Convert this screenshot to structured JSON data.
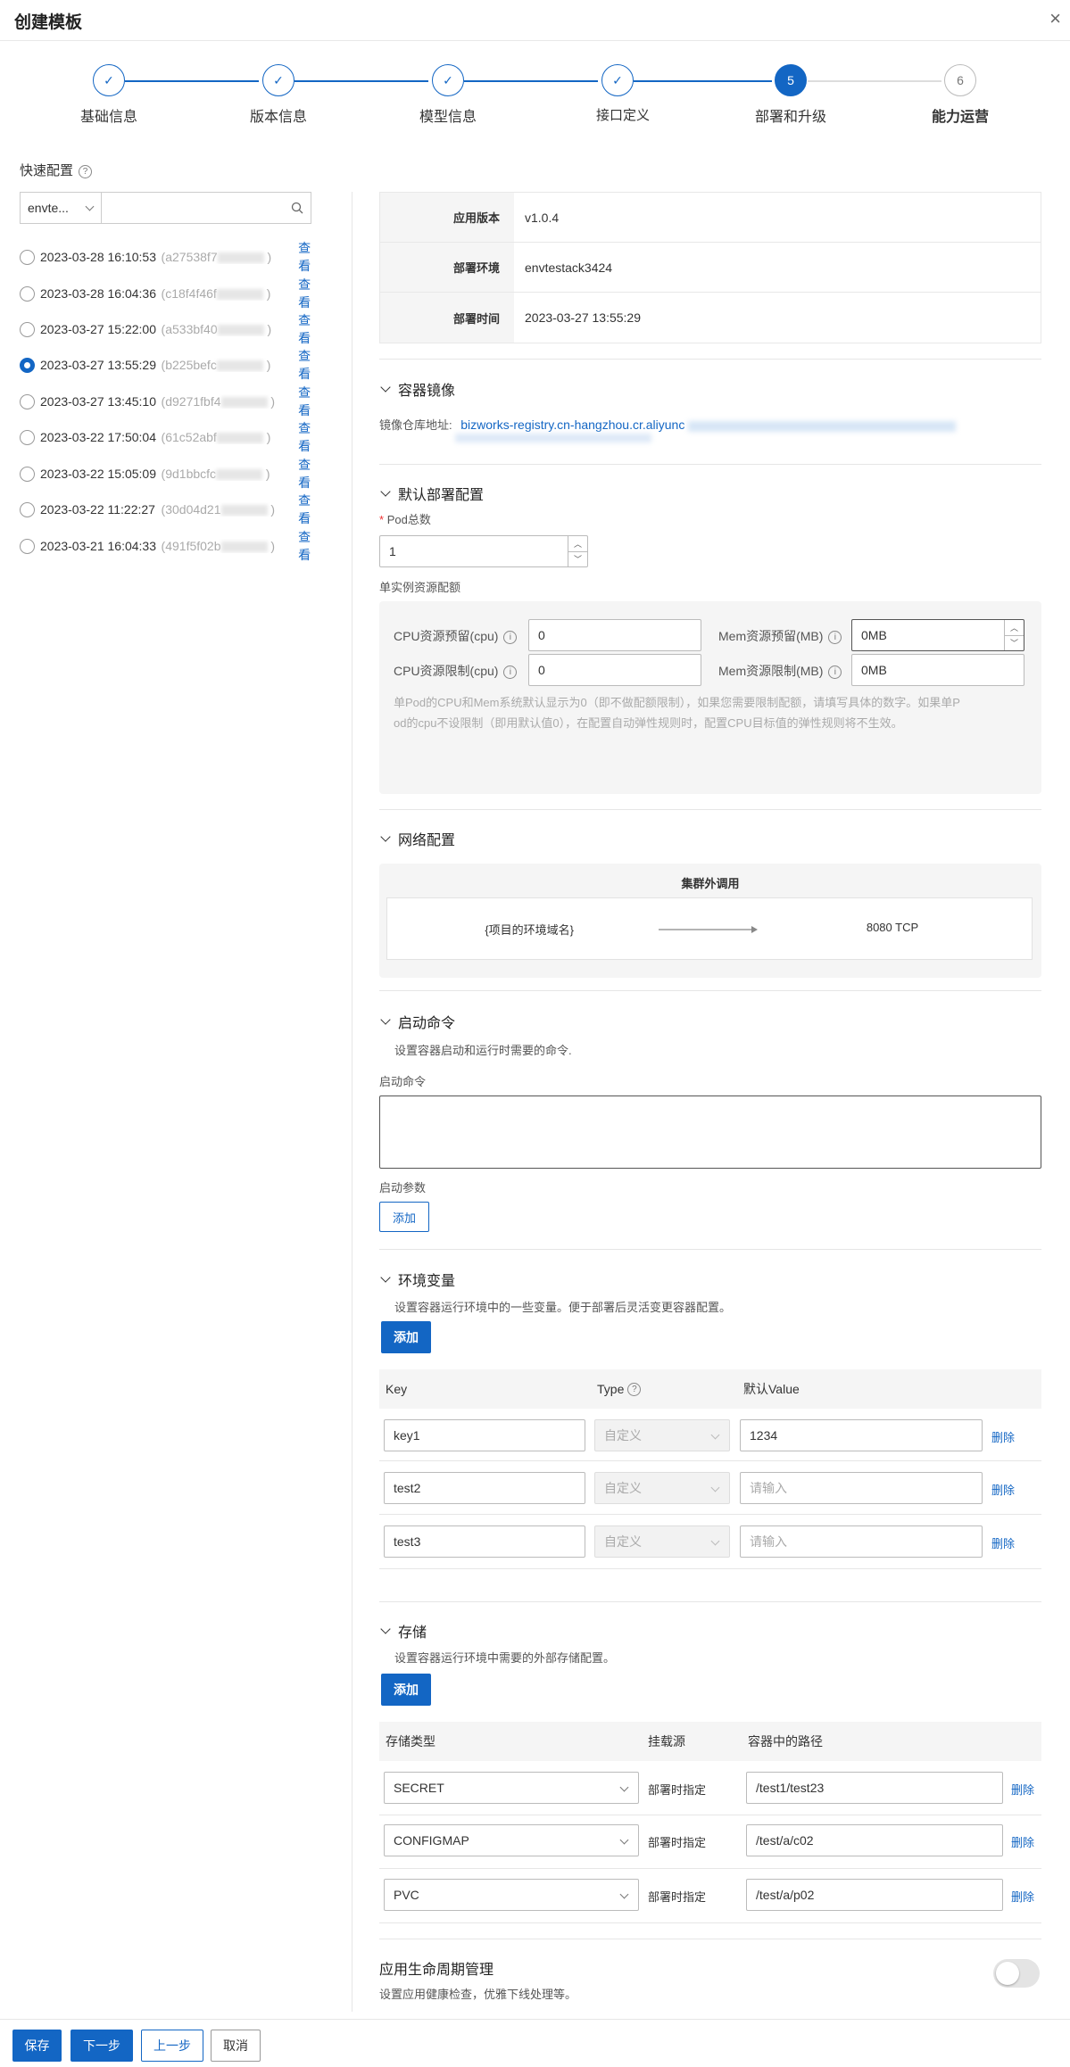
{
  "window": {
    "title": "创建模板",
    "close": "×"
  },
  "steps": [
    {
      "label": "基础信息",
      "mark": "✓"
    },
    {
      "label": "版本信息",
      "mark": "✓"
    },
    {
      "label": "模型信息",
      "mark": "✓"
    },
    {
      "label": "接口定义",
      "mark": "✓"
    },
    {
      "label": "部署和升级",
      "mark": "5"
    },
    {
      "label": "能力运营",
      "mark": "6"
    }
  ],
  "quick_config": {
    "title": "快速配置",
    "help": "?",
    "env_value": "envte...",
    "search_placeholder": "",
    "history": [
      {
        "time": "2023-03-28 16:10:53",
        "hash": "(a27538f7",
        "close": ")",
        "action": "查看"
      },
      {
        "time": "2023-03-28 16:04:36",
        "hash": "(c18f4f46f",
        "close": ")",
        "action": "查看"
      },
      {
        "time": "2023-03-27 15:22:00",
        "hash": "(a533bf40",
        "close": ")",
        "action": "查看"
      },
      {
        "time": "2023-03-27 13:55:29",
        "hash": "(b225befc",
        "close": ")",
        "action": "查看"
      },
      {
        "time": "2023-03-27 13:45:10",
        "hash": "(d9271fbf4",
        "close": ")",
        "action": "查看"
      },
      {
        "time": "2023-03-22 17:50:04",
        "hash": "(61c52abf",
        "close": ")",
        "action": "查看"
      },
      {
        "time": "2023-03-22 15:05:09",
        "hash": "(9d1bbcfc",
        "close": ")",
        "action": "查看"
      },
      {
        "time": "2023-03-22 11:22:27",
        "hash": "(30d04d21",
        "close": ")",
        "action": "查看"
      },
      {
        "time": "2023-03-21 16:04:33",
        "hash": "(491f5f02b",
        "close": ")",
        "action": "查看"
      }
    ]
  },
  "info": [
    {
      "key": "应用版本",
      "value": "v1.0.4"
    },
    {
      "key": "部署环境",
      "value": "envtestack3424"
    },
    {
      "key": "部署时间",
      "value": "2023-03-27 13:55:29"
    }
  ],
  "image": {
    "title": "容器镜像",
    "repo_label": "镜像仓库地址:",
    "repo_value": "bizworks-registry.cn-hangzhou.cr.aliyunc"
  },
  "deploy": {
    "title": "默认部署配置",
    "pod_label": "Pod总数",
    "pod_value": "1",
    "quota_label": "单实例资源配额",
    "cpu_req_label": "CPU资源预留(cpu)",
    "cpu_req_value": "0",
    "mem_req_label": "Mem资源预留(MB)",
    "mem_req_value": "0MB",
    "cpu_lim_label": "CPU资源限制(cpu)",
    "cpu_lim_value": "0",
    "mem_lim_label": "Mem资源限制(MB)",
    "mem_lim_value": "0MB",
    "note_line1": "单Pod的CPU和Mem系统默认显示为0（即不做配额限制），如果您需要限制配额，请填写具体的数字。如果单P",
    "note_line2": "od的cpu不设限制（即用默认值0），在配置自动弹性规则时，配置CPU目标值的弹性规则将不生效。"
  },
  "network": {
    "title": "网络配置",
    "card_title": "集群外调用",
    "source": "{项目的环境域名}",
    "target": "8080 TCP"
  },
  "startup": {
    "title": "启动命令",
    "desc": "设置容器启动和运行时需要的命令.",
    "cmd_label": "启动命令",
    "args_label": "启动参数",
    "add": "添加"
  },
  "env": {
    "title": "环境变量",
    "desc": "设置容器运行环境中的一些变量。便于部署后灵活变更容器配置。",
    "add": "添加",
    "headers": {
      "key": "Key",
      "type": "Type",
      "value": "默认Value"
    },
    "rows": [
      {
        "key": "key1",
        "type": "自定义",
        "value": "1234",
        "action": "删除"
      },
      {
        "key": "test2",
        "type": "自定义",
        "value": "请输入",
        "action": "删除"
      },
      {
        "key": "test3",
        "type": "自定义",
        "value": "请输入",
        "action": "删除"
      }
    ]
  },
  "storage": {
    "title": "存储",
    "desc": "设置容器运行环境中需要的外部存储配置。",
    "add": "添加",
    "headers": {
      "type": "存储类型",
      "source": "挂载源",
      "path": "容器中的路径"
    },
    "rows": [
      {
        "type": "SECRET",
        "source": "部署时指定",
        "path": "/test1/test23",
        "action": "删除"
      },
      {
        "type": "CONFIGMAP",
        "source": "部署时指定",
        "path": "/test/a/c02",
        "action": "删除"
      },
      {
        "type": "PVC",
        "source": "部署时指定",
        "path": "/test/a/p02",
        "action": "删除"
      }
    ]
  },
  "lifecycle": {
    "title": "应用生命周期管理",
    "desc": "设置应用健康检查，优雅下线处理等。",
    "enabled": false
  },
  "footer": {
    "save": "保存",
    "next": "下一步",
    "prev": "上一步",
    "cancel": "取消"
  },
  "colors": {
    "accent": "#1366c4"
  }
}
